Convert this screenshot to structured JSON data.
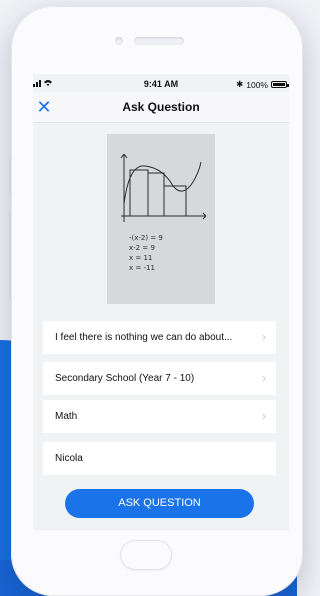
{
  "status_bar": {
    "signal": "▐█▐ •",
    "time": "9:41 AM",
    "bluetooth": "✱",
    "battery_percent": "100%"
  },
  "nav": {
    "close_icon": "✕",
    "title": "Ask Question"
  },
  "photo": {
    "handwriting": [
      "-(x-2) = 9",
      "x-2 = 9",
      "x = 11",
      "x = -11"
    ]
  },
  "form": {
    "question_text": "I feel there is nothing we can do about...",
    "school_level": "Secondary School (Year 7 - 10)",
    "subject": "Math",
    "name": "Nicola",
    "chevron": "›"
  },
  "actions": {
    "ask_label": "ASK QUESTION"
  },
  "colors": {
    "accent": "#1a73e8",
    "background_wave": "#1a6fe0"
  }
}
